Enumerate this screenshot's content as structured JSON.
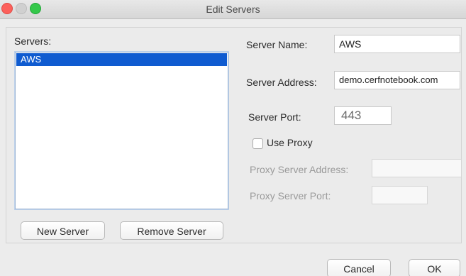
{
  "window": {
    "title": "Edit Servers"
  },
  "servers": {
    "label": "Servers:",
    "items": [
      {
        "label": "AWS",
        "selected": true
      }
    ]
  },
  "buttons": {
    "new_server": "New Server",
    "remove_server": "Remove Server",
    "cancel": "Cancel",
    "ok": "OK"
  },
  "form": {
    "server_name_label": "Server Name:",
    "server_name_value": "AWS",
    "server_address_label": "Server Address:",
    "server_address_value": "demo.cerfnotebook.com",
    "server_port_label": "Server Port:",
    "server_port_value": "443",
    "use_proxy_label": "Use Proxy",
    "use_proxy_checked": false,
    "proxy_address_label": "Proxy Server Address:",
    "proxy_address_value": "",
    "proxy_port_label": "Proxy Server Port:",
    "proxy_port_value": ""
  },
  "colors": {
    "selection": "#0f5bd0",
    "traffic_close": "#fc605b",
    "traffic_max": "#34c84a"
  }
}
